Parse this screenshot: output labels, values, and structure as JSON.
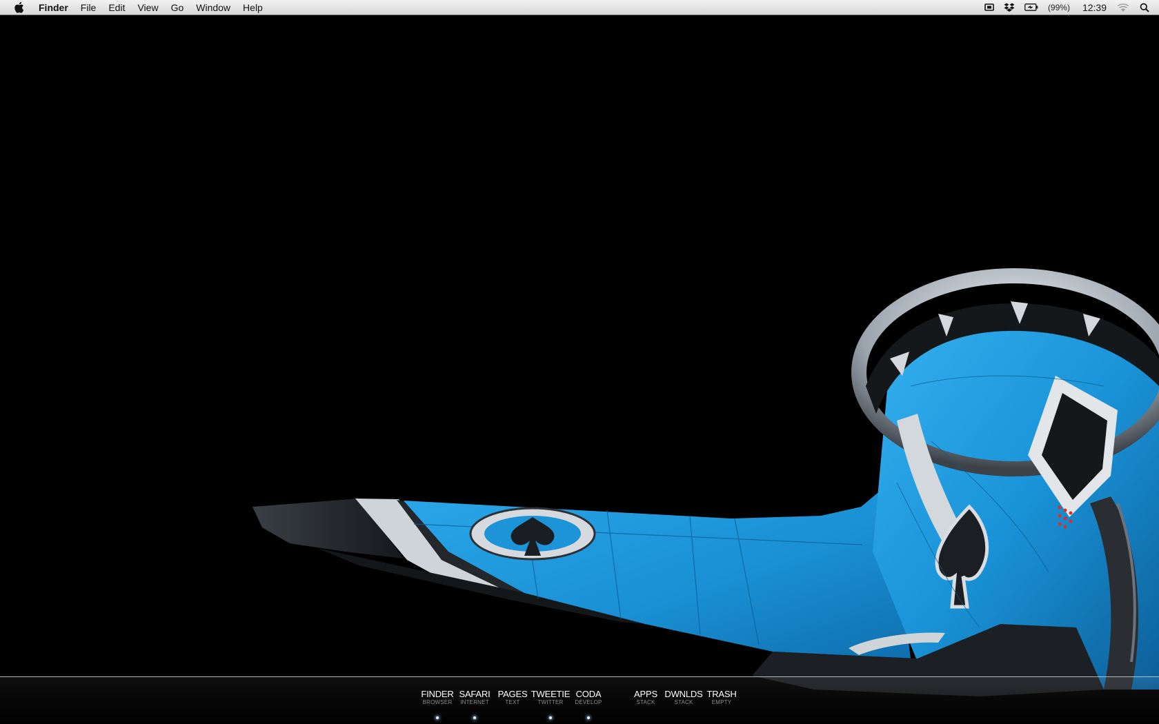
{
  "menubar": {
    "apple_icon": "apple-logo-icon",
    "app_name": "Finder",
    "items": [
      {
        "label": "File"
      },
      {
        "label": "Edit"
      },
      {
        "label": "View"
      },
      {
        "label": "Go"
      },
      {
        "label": "Window"
      },
      {
        "label": "Help"
      }
    ],
    "status": {
      "icons": [
        "display-mirror-icon",
        "dropbox-icon",
        "battery-icon",
        "wifi-icon",
        "spotlight-search-icon"
      ],
      "battery_percent": "(99%)",
      "clock": "12:39"
    }
  },
  "wallpaper": {
    "description_icon": "airplane-wing-icon",
    "colors": {
      "background": "#000000",
      "plane_blue": "#1f9be0",
      "plane_dark": "#1a1c20",
      "plane_white": "#d9dde2"
    }
  },
  "dock": {
    "items": [
      {
        "title": "FINDER",
        "sub": "BROWSER",
        "running": true
      },
      {
        "title": "SAFARI",
        "sub": "INTERNET",
        "running": true
      },
      {
        "title": "PAGES",
        "sub": "TEXT",
        "running": false
      },
      {
        "title": "TWEETIE",
        "sub": "TWITTER",
        "running": true
      },
      {
        "title": "CODA",
        "sub": "DEVELOP",
        "running": true
      },
      {
        "title": "APPS",
        "sub": "STACK",
        "running": false
      },
      {
        "title": "DWNLDS",
        "sub": "STACK",
        "running": false
      },
      {
        "title": "TRASH",
        "sub": "EMPTY",
        "running": false
      }
    ]
  }
}
